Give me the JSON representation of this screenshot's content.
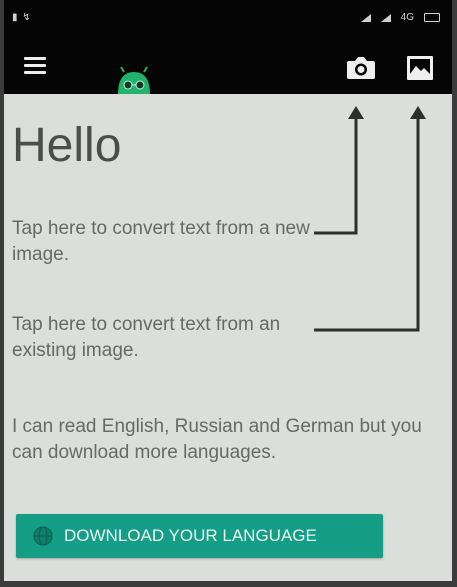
{
  "statusbar": {
    "left_text": "▮ ↯",
    "network": "4G"
  },
  "toolbar": {
    "menu_icon": "hamburger-menu-icon",
    "logo_icon": "robot-logo-icon",
    "camera_icon": "camera-icon",
    "gallery_icon": "image-gallery-icon"
  },
  "main": {
    "greeting": "Hello",
    "camera_hint": "Tap here to convert text from a new image.",
    "gallery_hint": "Tap here to convert text from an existing image.",
    "languages_note": "I can read English, Russian and German but you can download more languages.",
    "download_button": "DOWNLOAD YOUR LANGUAGE"
  },
  "colors": {
    "toolbar": "#050505",
    "background": "#dcdedb",
    "accent": "#139e85",
    "logo": "#1fb36b"
  }
}
